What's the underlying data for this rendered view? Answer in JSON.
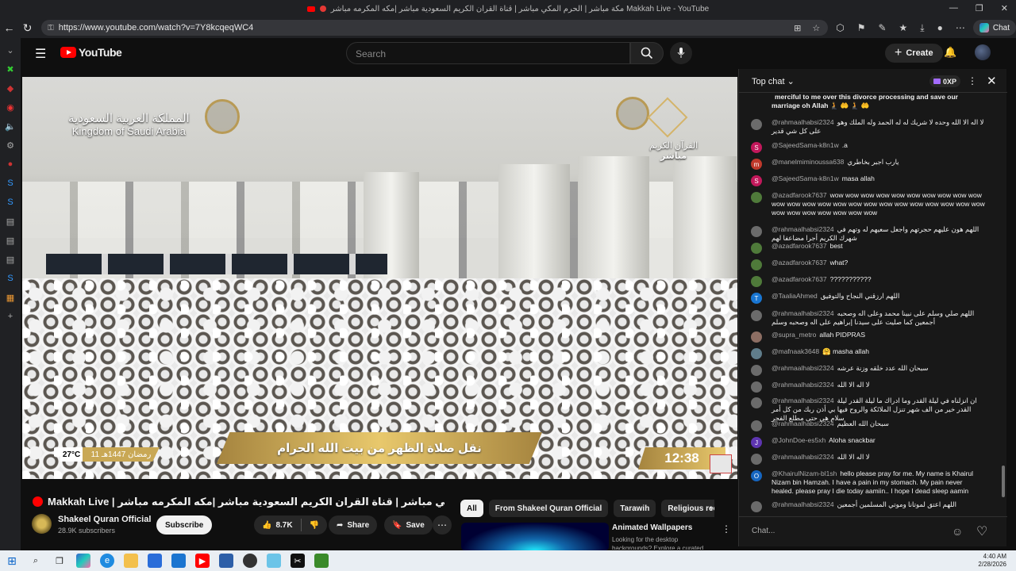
{
  "browser": {
    "window_title": "مكة مباشر | الحرم المكي مباشر | قناة القران الكريم السعودية مباشر |مكه المكرمه مباشر Makkah Live - YouTube",
    "url": "https://www.youtube.com/watch?v=7Y8kcqeqWC4",
    "chat_button": "Chat"
  },
  "youtube": {
    "logo_text": "YouTube",
    "search_placeholder": "Search",
    "create_label": "Create"
  },
  "video_overlay": {
    "ksa_arabic": "المملكة العربية السعودية",
    "ksa_english": "Kingdom of Saudi Arabia",
    "channel_name_ar": "القرآن الكريم",
    "channel_live_ar": "مباشر",
    "ticker": "نقل صلاة الظهر من بيت الله الحرام",
    "temperature": "27°C",
    "hijri_date": "11 رمضان 1447هـ",
    "clock": "12:38"
  },
  "video": {
    "title": "Makkah Live | مكة مباشر | الحرم المكي مباشر | قناة القران الكريم السعودية مباشر |مكه المكرمه مباشر",
    "channel": "Shakeel Quran Official",
    "subscribers": "28.9K subscribers",
    "subscribe_label": "Subscribe",
    "likes": "8.7K",
    "share_label": "Share",
    "save_label": "Save"
  },
  "chips": [
    "All",
    "From Shakeel Quran Official",
    "Tarawih",
    "Religious recitat"
  ],
  "recommendation": {
    "title": "Animated Wallpapers",
    "description": "Looking for the desktop backgrounds? Explore a curated"
  },
  "chat": {
    "mode": "Top chat",
    "xp": "0XP",
    "input_placeholder": "Chat...",
    "messages": [
      {
        "author": "",
        "text": "merciful to me over this divorce processing and save our marriage oh Allah 🧎 🤲 🧎 🤲",
        "color": "#5a4a3a",
        "initial": ""
      },
      {
        "author": "@rahmaalhabsi2324",
        "text": "لا اله الا الله وحده لا شريك له له الحمد وله الملك وهو على كل شي قدير",
        "color": "#6b6b6b",
        "initial": ""
      },
      {
        "author": "@SajeedSama-k8n1w",
        "text": ".a",
        "color": "#c2185b",
        "initial": "S"
      },
      {
        "author": "@manelmiminoussa638",
        "text": "يارب اجبر بخاطري",
        "color": "#c0392b",
        "initial": "m"
      },
      {
        "author": "@SajeedSama-k8n1w",
        "text": "masa allah",
        "color": "#c2185b",
        "initial": "S"
      },
      {
        "author": "@azadfarook7637",
        "text": "wow wow wow wow wow wow wow wow wow wow wow wow wow wow wow wow wow wow wow wow wow wow wow wow wow wow wow wow wow wow wow",
        "color": "#4f7a3a",
        "initial": ""
      },
      {
        "author": "@rahmaalhabsi2324",
        "text": "اللهم هون عليهم حجرتهم واجعل سعيهم له وتهم في شهرك الكريم أجرا مضاعفا لهم",
        "color": "#6b6b6b",
        "initial": ""
      },
      {
        "author": "@azadfarook7637",
        "text": "best",
        "color": "#4f7a3a",
        "initial": ""
      },
      {
        "author": "@azadfarook7637",
        "text": "what?",
        "color": "#4f7a3a",
        "initial": ""
      },
      {
        "author": "@azadfarook7637",
        "text": "???????????",
        "color": "#4f7a3a",
        "initial": ""
      },
      {
        "author": "@TaaliaAhmed",
        "text": "اللهم ارزقني النجاح والتوفيق",
        "color": "#1976d2",
        "initial": "T"
      },
      {
        "author": "@rahmaalhabsi2324",
        "text": "اللهم صلي وسلم على نبينا محمد وعلى اله وصحبه أجمعين كما صليت على سيدنا إبراهيم على اله وصحبه وسلم",
        "color": "#6b6b6b",
        "initial": ""
      },
      {
        "author": "@supra_metro",
        "text": "allah PIDPRAS",
        "color": "#8d6e63",
        "initial": ""
      },
      {
        "author": "@mafnaak3648",
        "text": "🤗 masha allah",
        "color": "#607d8b",
        "initial": ""
      },
      {
        "author": "@rahmaalhabsi2324",
        "text": "سبحان الله عدد خلقه وزنة عرشه",
        "color": "#6b6b6b",
        "initial": ""
      },
      {
        "author": "@rahmaalhabsi2324",
        "text": "لا اله الا الله",
        "color": "#6b6b6b",
        "initial": ""
      },
      {
        "author": "@rahmaalhabsi2324",
        "text": "ان انزلناه في ليلة القدر وما ادراك ما ليلة القدر ليلة القدر خير من الف شهر تنزل الملائكة والروح فيها بي أذن ربك من كل أمر سلام هي حتى مطلع الفجر",
        "color": "#6b6b6b",
        "initial": ""
      },
      {
        "author": "@rahmaalhabsi2324",
        "text": "سبحان الله العظيم",
        "color": "#6b6b6b",
        "initial": ""
      },
      {
        "author": "@JohnDoe-es5xh",
        "text": "Aloha snackbar",
        "color": "#5e35b1",
        "initial": "J"
      },
      {
        "author": "@rahmaalhabsi2324",
        "text": "لا اله الا الله",
        "color": "#6b6b6b",
        "initial": ""
      },
      {
        "author": "@KhairulNizam-bl1sh",
        "text": "hello please pray for me. My name is Khairul Nizam bin Hamzah. I have a pain in my stomach. My pain never healed. please pray I die today aamiin.. I hope I dead sleep aamin",
        "color": "#1565c0",
        "initial": "O"
      },
      {
        "author": "@rahmaalhabsi2324",
        "text": "اللهم اعتق لموتانا وموتي المسلمين أجمعين",
        "color": "#6b6b6b",
        "initial": ""
      }
    ]
  },
  "taskbar": {
    "time": "4:40 AM",
    "date": "2/28/2026"
  }
}
